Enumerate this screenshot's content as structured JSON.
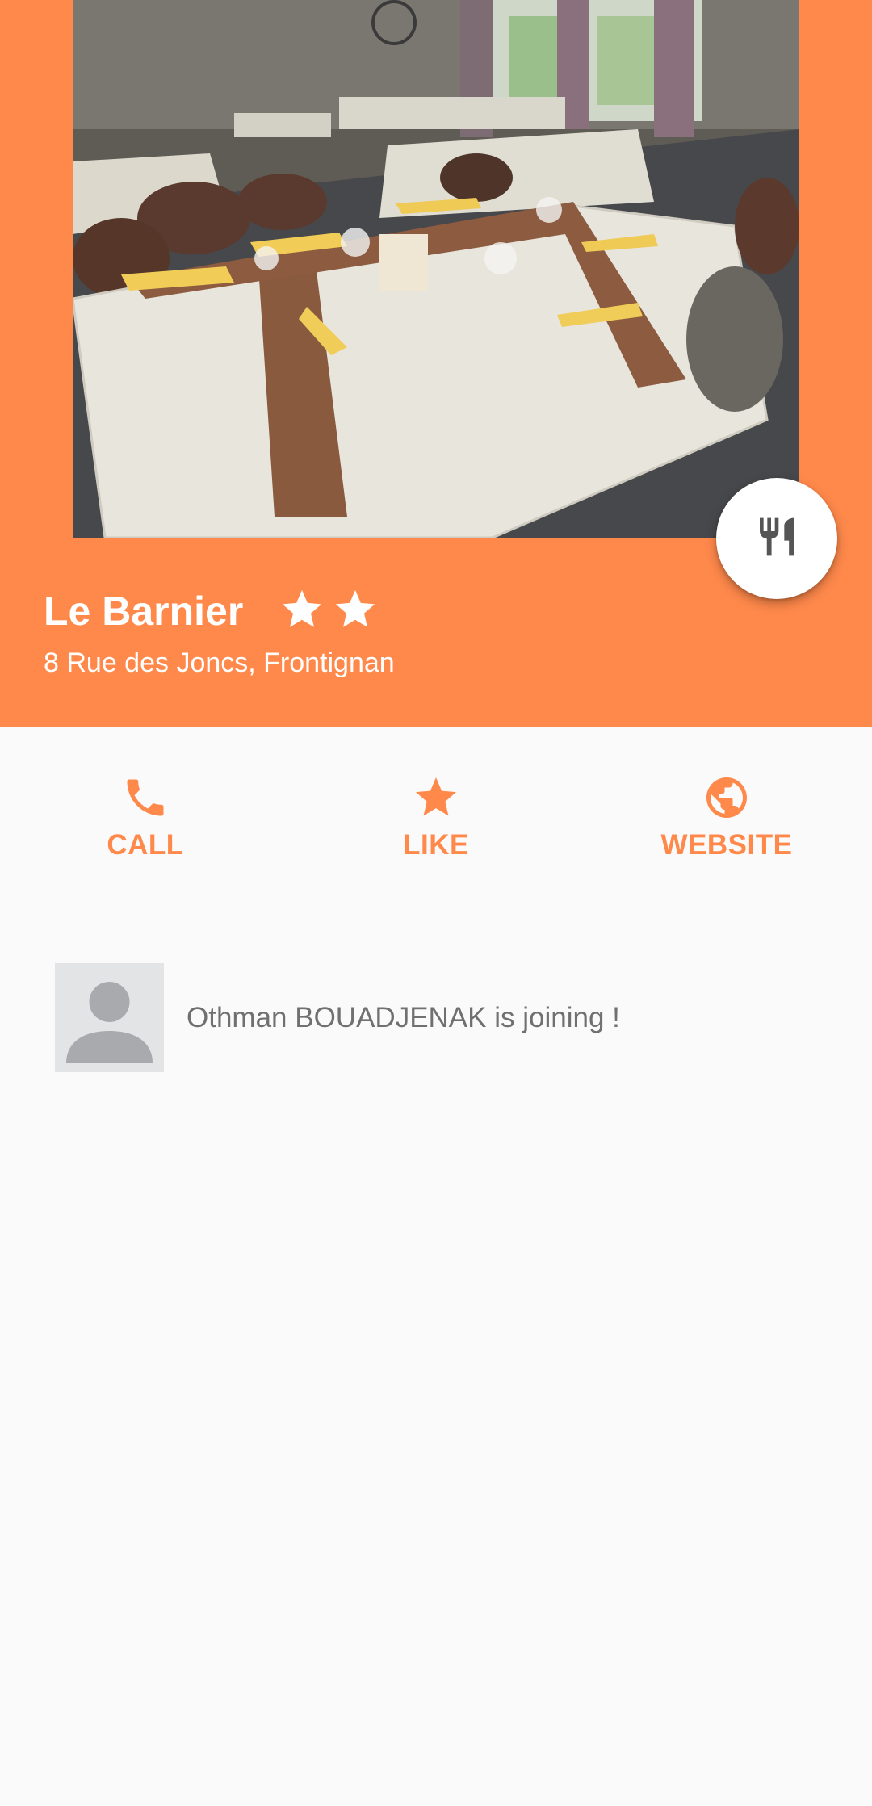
{
  "venue": {
    "name": "Le Barnier",
    "rating_stars": 2,
    "address": "8 Rue des Joncs, Frontignan",
    "photo_icon": "restaurant-photo",
    "category_icon": "fork-knife-icon"
  },
  "colors": {
    "accent": "#ff894b",
    "background": "#fafafa",
    "feed_text": "#707070"
  },
  "actions": [
    {
      "label": "CALL",
      "icon": "phone-icon"
    },
    {
      "label": "LIKE",
      "icon": "star-icon"
    },
    {
      "label": "WEBSITE",
      "icon": "globe-icon"
    }
  ],
  "feed": [
    {
      "text": "Othman BOUADJENAK is joining !",
      "avatar_icon": "default-avatar-icon"
    }
  ]
}
